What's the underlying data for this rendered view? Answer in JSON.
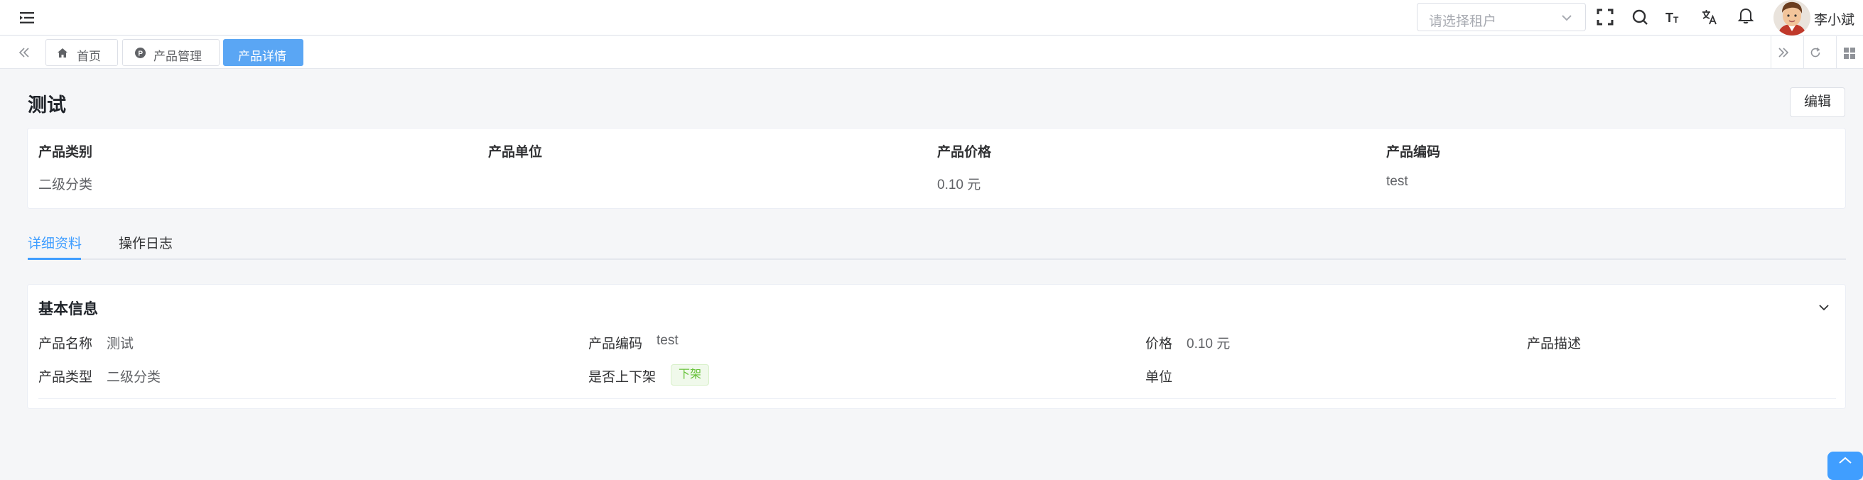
{
  "header": {
    "tenant_placeholder": "请选择租户",
    "user_name": "李小斌",
    "icons": [
      "menu-fold-icon",
      "fullscreen-icon",
      "search-icon",
      "font-size-icon",
      "translate-icon",
      "bell-icon"
    ]
  },
  "tabs": [
    {
      "label": "首页",
      "icon": "home-icon"
    },
    {
      "label": "产品管理",
      "icon": "product-icon"
    },
    {
      "label": "产品详情",
      "active": true
    }
  ],
  "page": {
    "title": "测试",
    "edit_label": "编辑"
  },
  "summary": [
    {
      "label": "产品类别",
      "value": "二级分类"
    },
    {
      "label": "产品单位",
      "value": ""
    },
    {
      "label": "产品价格",
      "value": "0.10 元"
    },
    {
      "label": "产品编码",
      "value": "test"
    }
  ],
  "detail_tabs": [
    {
      "label": "详细资料",
      "active": true
    },
    {
      "label": "操作日志"
    }
  ],
  "basic_info": {
    "title": "基本信息",
    "fields": [
      {
        "label": "产品名称",
        "value": "测试"
      },
      {
        "label": "产品编码",
        "value": "test"
      },
      {
        "label": "价格",
        "value": "0.10 元"
      },
      {
        "label": "产品描述",
        "value": ""
      },
      {
        "label": "产品类型",
        "value": "二级分类"
      },
      {
        "label": "是否上下架",
        "value": "下架"
      },
      {
        "label": "单位",
        "value": ""
      }
    ]
  },
  "colors": {
    "primary": "#409eff",
    "active_tab": "#5aa6f4",
    "tag_green": "#67c23a"
  }
}
